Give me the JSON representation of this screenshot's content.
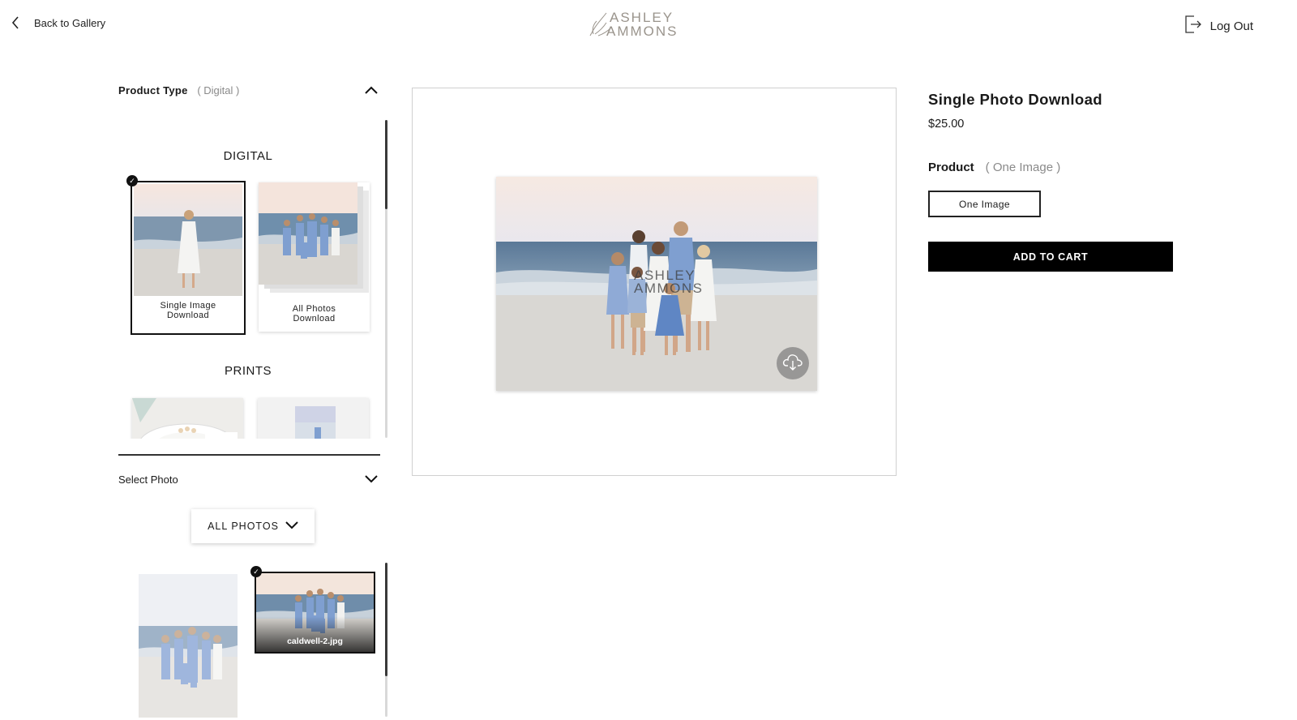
{
  "header": {
    "back_label": "Back to Gallery",
    "logo_line1": "ASHLEY",
    "logo_line2": "AMMONS",
    "logout_label": "Log Out"
  },
  "product_type": {
    "label": "Product Type",
    "value": "( Digital )",
    "categories": [
      {
        "title": "DIGITAL",
        "items": [
          {
            "label_line1": "Single Image",
            "label_line2": "Download",
            "selected": true
          },
          {
            "label_line1": "All Photos",
            "label_line2": "Download",
            "selected": false
          }
        ]
      },
      {
        "title": "PRINTS",
        "items": []
      }
    ]
  },
  "select_photo": {
    "label": "Select Photo",
    "filter_label": "ALL PHOTOS",
    "photos": [
      {
        "filename": "",
        "selected": false
      },
      {
        "filename": "caldwell-2.jpg",
        "selected": true
      }
    ]
  },
  "preview": {
    "watermark_line1": "ASHLEY",
    "watermark_line2": "AMMONS"
  },
  "details": {
    "name": "Single Photo Download",
    "price": "$25.00",
    "product_label": "Product",
    "product_value": "( One Image )",
    "option_label": "One Image",
    "add_to_cart": "ADD TO CART"
  },
  "colors": {
    "accent": "#000000",
    "logo": "#9a948c",
    "sky": "#f3e6de",
    "sea": "#6d8aa8",
    "sand": "#dad8d4"
  }
}
